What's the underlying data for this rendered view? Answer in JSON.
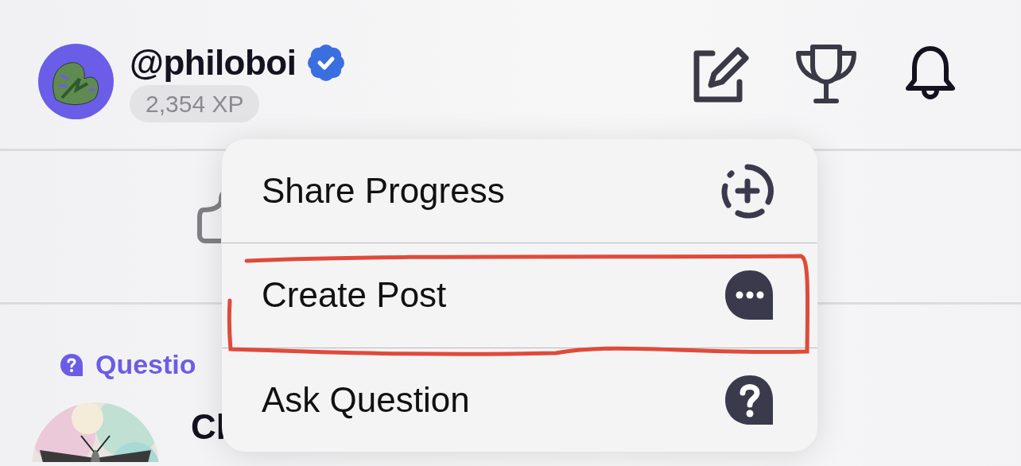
{
  "profile": {
    "username": "@philoboi",
    "verified": true,
    "xp": "2,354 XP"
  },
  "menu": {
    "items": [
      {
        "kind": "share",
        "label": "Share Progress",
        "highlighted": false
      },
      {
        "kind": "post",
        "label": "Create Post",
        "highlighted": true
      },
      {
        "kind": "question",
        "label": "Ask Question",
        "highlighted": false
      }
    ]
  },
  "feed": {
    "category": "Questio",
    "post_title": "Cl"
  }
}
